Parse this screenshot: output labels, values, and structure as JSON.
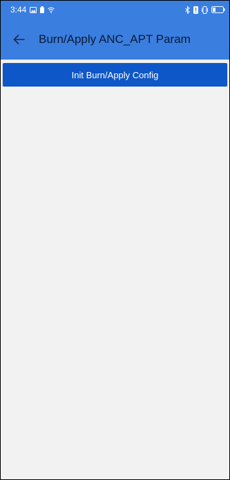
{
  "status_bar": {
    "time": "3:44",
    "left_icons": [
      "image-notification-icon",
      "battery-saver-icon",
      "wifi-icon"
    ],
    "right_icons": [
      "bluetooth-icon",
      "alert-icon",
      "vibrate-icon",
      "battery-icon"
    ]
  },
  "app_bar": {
    "back_icon": "arrow-left-icon",
    "title": "Burn/Apply ANC_APT Param"
  },
  "main": {
    "init_button_label": "Init Burn/Apply Config"
  },
  "colors": {
    "app_bar": "#3a7ee0",
    "button": "#0e57c8",
    "background": "#f2f2f2"
  }
}
